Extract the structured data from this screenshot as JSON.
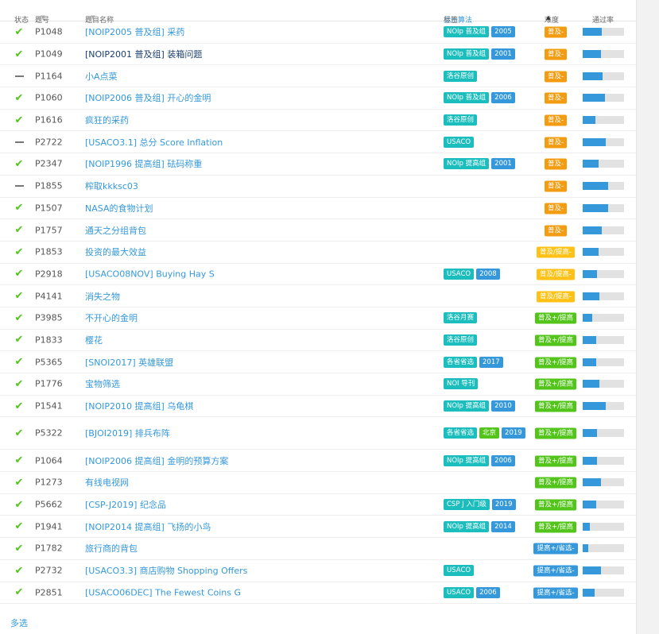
{
  "header": {
    "status": "状态",
    "pid": "题号",
    "name": "题目名称",
    "show_algo": "显示算法",
    "tags": "标签",
    "difficulty": "难度",
    "pass_rate": "通过率"
  },
  "colors": {
    "link": "#3498db",
    "ac_green": "#52c41a",
    "source_tag": "#1cbdbd",
    "year_tag": "#3498db",
    "diff_orange": "#f39c11",
    "diff_yellow": "#ffc116",
    "diff_green": "#52c41a",
    "diff_blue": "#3498db",
    "passbar": "#3498db"
  },
  "rows": [
    {
      "status": "ac",
      "pid": "P1048",
      "name": "[NOIP2005 普及组] 采药",
      "visited": false,
      "tags": [
        {
          "text": "NOIp 普及组",
          "kind": "source"
        },
        {
          "text": "2005",
          "kind": "year"
        }
      ],
      "difficulty": "普及-",
      "diff_color": "#f39c11",
      "pass": 0.46
    },
    {
      "status": "ac",
      "pid": "P1049",
      "name": "[NOIP2001 普及组] 装箱问题",
      "visited": true,
      "tags": [
        {
          "text": "NOIp 普及组",
          "kind": "source"
        },
        {
          "text": "2001",
          "kind": "year"
        }
      ],
      "difficulty": "普及-",
      "diff_color": "#f39c11",
      "pass": 0.44
    },
    {
      "status": "none",
      "pid": "P1164",
      "name": "小A点菜",
      "visited": false,
      "tags": [
        {
          "text": "洛谷原创",
          "kind": "source"
        }
      ],
      "difficulty": "普及-",
      "diff_color": "#f39c11",
      "pass": 0.48
    },
    {
      "status": "ac",
      "pid": "P1060",
      "name": "[NOIP2006 普及组] 开心的金明",
      "visited": false,
      "tags": [
        {
          "text": "NOIp 普及组",
          "kind": "source"
        },
        {
          "text": "2006",
          "kind": "year"
        }
      ],
      "difficulty": "普及-",
      "diff_color": "#f39c11",
      "pass": 0.54
    },
    {
      "status": "ac",
      "pid": "P1616",
      "name": "疯狂的采药",
      "visited": false,
      "tags": [
        {
          "text": "洛谷原创",
          "kind": "source"
        }
      ],
      "difficulty": "普及-",
      "diff_color": "#f39c11",
      "pass": 0.3
    },
    {
      "status": "none",
      "pid": "P2722",
      "name": "[USACO3.1] 总分 Score Inflation",
      "visited": false,
      "tags": [
        {
          "text": "USACO",
          "kind": "source"
        }
      ],
      "difficulty": "普及-",
      "diff_color": "#f39c11",
      "pass": 0.56
    },
    {
      "status": "ac",
      "pid": "P2347",
      "name": "[NOIP1996 提高组] 砝码称重",
      "visited": false,
      "tags": [
        {
          "text": "NOIp 提高组",
          "kind": "source"
        },
        {
          "text": "2001",
          "kind": "year"
        }
      ],
      "difficulty": "普及-",
      "diff_color": "#f39c11",
      "pass": 0.38
    },
    {
      "status": "none",
      "pid": "P1855",
      "name": "榨取kkksc03",
      "visited": false,
      "tags": [],
      "difficulty": "普及-",
      "diff_color": "#f39c11",
      "pass": 0.62
    },
    {
      "status": "ac",
      "pid": "P1507",
      "name": "NASA的食物计划",
      "visited": false,
      "tags": [],
      "difficulty": "普及-",
      "diff_color": "#f39c11",
      "pass": 0.62
    },
    {
      "status": "ac",
      "pid": "P1757",
      "name": "通天之分组背包",
      "visited": false,
      "tags": [],
      "difficulty": "普及-",
      "diff_color": "#f39c11",
      "pass": 0.46
    },
    {
      "status": "ac",
      "pid": "P1853",
      "name": "投资的最大效益",
      "visited": false,
      "tags": [],
      "difficulty": "普及/提高-",
      "diff_color": "#ffc116",
      "pass": 0.38
    },
    {
      "status": "ac",
      "pid": "P2918",
      "name": "[USACO08NOV] Buying Hay S",
      "visited": false,
      "tags": [
        {
          "text": "USACO",
          "kind": "source"
        },
        {
          "text": "2008",
          "kind": "year"
        }
      ],
      "difficulty": "普及/提高-",
      "diff_color": "#ffc116",
      "pass": 0.34
    },
    {
      "status": "ac",
      "pid": "P4141",
      "name": "消失之物",
      "visited": false,
      "tags": [],
      "difficulty": "普及/提高-",
      "diff_color": "#ffc116",
      "pass": 0.4
    },
    {
      "status": "ac",
      "pid": "P3985",
      "name": "不开心的金明",
      "visited": false,
      "tags": [
        {
          "text": "洛谷月赛",
          "kind": "source"
        }
      ],
      "difficulty": "普及+/提高",
      "diff_color": "#52c41a",
      "pass": 0.24
    },
    {
      "status": "ac",
      "pid": "P1833",
      "name": "樱花",
      "visited": false,
      "tags": [
        {
          "text": "洛谷原创",
          "kind": "source"
        }
      ],
      "difficulty": "普及+/提高",
      "diff_color": "#52c41a",
      "pass": 0.32
    },
    {
      "status": "ac",
      "pid": "P5365",
      "name": "[SNOI2017] 英雄联盟",
      "visited": false,
      "tags": [
        {
          "text": "各省省选",
          "kind": "source"
        },
        {
          "text": "2017",
          "kind": "year"
        }
      ],
      "difficulty": "普及+/提高",
      "diff_color": "#52c41a",
      "pass": 0.32
    },
    {
      "status": "ac",
      "pid": "P1776",
      "name": "宝物筛选",
      "visited": false,
      "tags": [
        {
          "text": "NOI 导刊",
          "kind": "source"
        }
      ],
      "difficulty": "普及+/提高",
      "diff_color": "#52c41a",
      "pass": 0.4
    },
    {
      "status": "ac",
      "pid": "P1541",
      "name": "[NOIP2010 提高组] 乌龟棋",
      "visited": false,
      "tags": [
        {
          "text": "NOIp 提高组",
          "kind": "source"
        },
        {
          "text": "2010",
          "kind": "year"
        }
      ],
      "difficulty": "普及+/提高",
      "diff_color": "#52c41a",
      "pass": 0.56
    },
    {
      "status": "ac",
      "pid": "P5322",
      "name": "[BJOI2019] 排兵布阵",
      "visited": false,
      "tall": true,
      "tags": [
        {
          "text": "各省省选",
          "kind": "source"
        },
        {
          "text": "北京",
          "kind": "region"
        },
        {
          "text": "2019",
          "kind": "year"
        }
      ],
      "difficulty": "普及+/提高",
      "diff_color": "#52c41a",
      "pass": 0.34
    },
    {
      "status": "ac",
      "pid": "P1064",
      "name": "[NOIP2006 提高组] 金明的预算方案",
      "visited": false,
      "tags": [
        {
          "text": "NOIp 提高组",
          "kind": "source"
        },
        {
          "text": "2006",
          "kind": "year"
        }
      ],
      "difficulty": "普及+/提高",
      "diff_color": "#52c41a",
      "pass": 0.34
    },
    {
      "status": "ac",
      "pid": "P1273",
      "name": "有线电视网",
      "visited": false,
      "tags": [],
      "difficulty": "普及+/提高",
      "diff_color": "#52c41a",
      "pass": 0.44
    },
    {
      "status": "ac",
      "pid": "P5662",
      "name": "[CSP-J2019] 纪念品",
      "visited": false,
      "tags": [
        {
          "text": "CSP J 入门级",
          "kind": "source"
        },
        {
          "text": "2019",
          "kind": "year"
        }
      ],
      "difficulty": "普及+/提高",
      "diff_color": "#52c41a",
      "pass": 0.32
    },
    {
      "status": "ac",
      "pid": "P1941",
      "name": "[NOIP2014 提高组] 飞扬的小鸟",
      "visited": false,
      "tags": [
        {
          "text": "NOIp 提高组",
          "kind": "source"
        },
        {
          "text": "2014",
          "kind": "year"
        }
      ],
      "difficulty": "普及+/提高",
      "diff_color": "#52c41a",
      "pass": 0.18
    },
    {
      "status": "ac",
      "pid": "P1782",
      "name": "旅行商的背包",
      "visited": false,
      "tags": [],
      "difficulty": "提高+/省选-",
      "diff_color": "#3498db",
      "pass": 0.14
    },
    {
      "status": "ac",
      "pid": "P2732",
      "name": "[USACO3.3] 商店购物 Shopping Offers",
      "visited": false,
      "tags": [
        {
          "text": "USACO",
          "kind": "source"
        }
      ],
      "difficulty": "提高+/省选-",
      "diff_color": "#3498db",
      "pass": 0.44
    },
    {
      "status": "ac",
      "pid": "P2851",
      "name": "[USACO06DEC] The Fewest Coins G",
      "visited": false,
      "tags": [
        {
          "text": "USACO",
          "kind": "source"
        },
        {
          "text": "2006",
          "kind": "year"
        }
      ],
      "difficulty": "提高+/省选-",
      "diff_color": "#3498db",
      "pass": 0.28
    }
  ],
  "footer": {
    "multi_select": "多选"
  }
}
